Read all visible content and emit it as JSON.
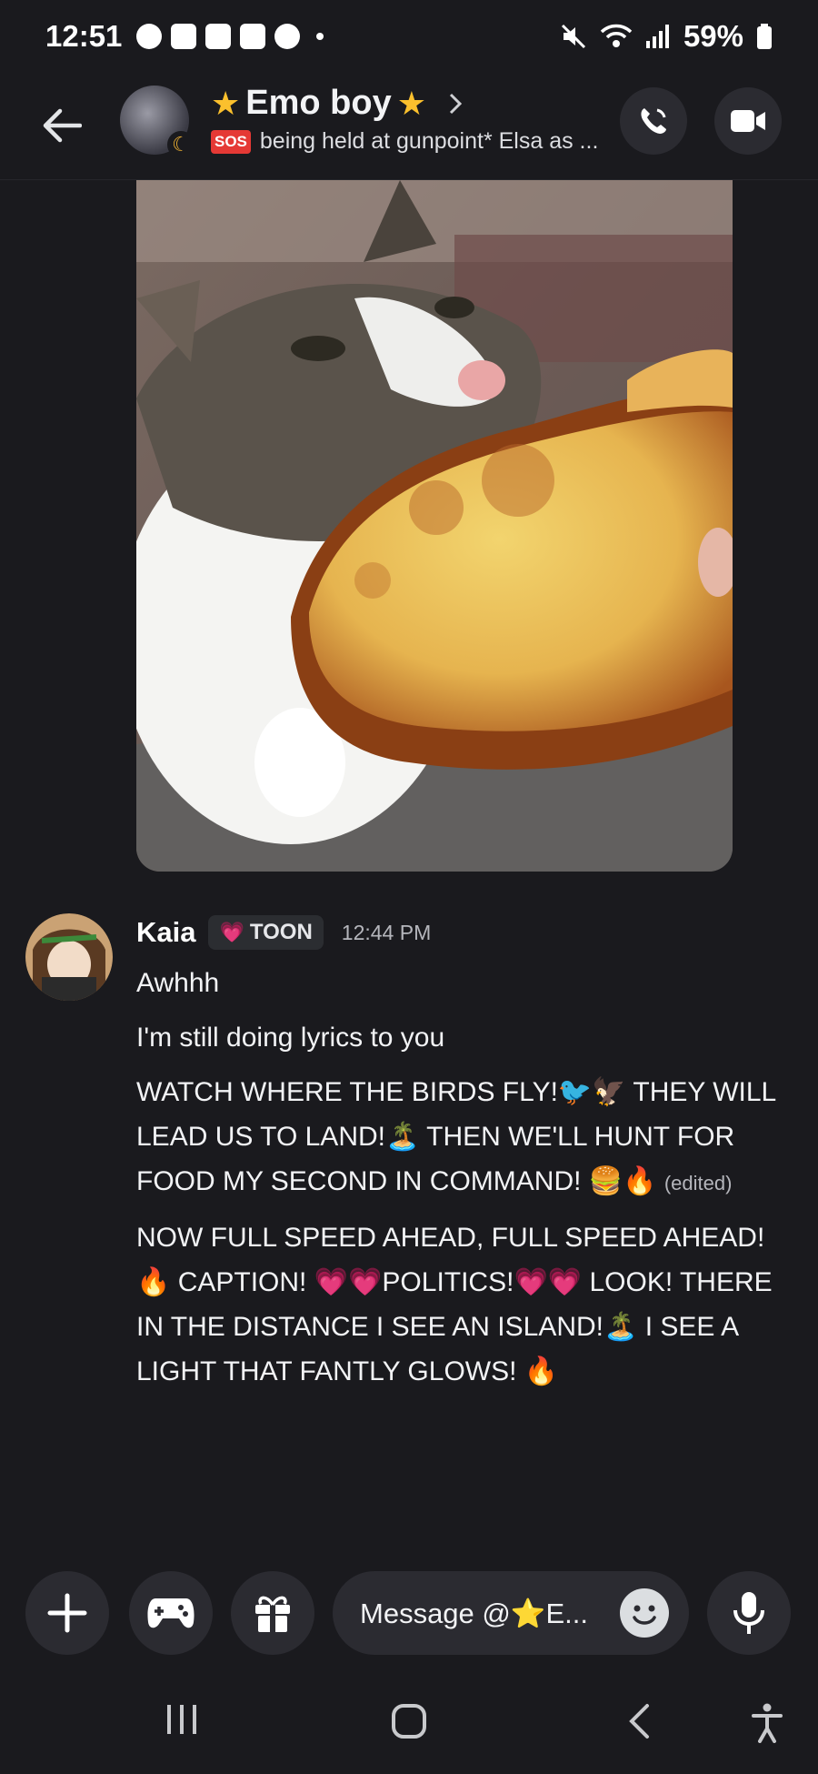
{
  "status_bar": {
    "time": "12:51",
    "battery": "59%"
  },
  "header": {
    "title_star_left": "★",
    "title": "Emo boy",
    "title_star_right": "★",
    "sos_badge": "SOS",
    "subtitle": "being held at gunpoint* Elsa as ..."
  },
  "message": {
    "username": "Kaia",
    "tag_label": "TOON",
    "timestamp": "12:44 PM",
    "lines": [
      "Awhhh",
      "I'm still doing lyrics to you"
    ],
    "verse1_a": "WATCH WHERE THE BIRDS FLY!🐦🦅 THEY WILL LEAD US TO LAND!🏝️ THEN WE'LL HUNT FOR FOOD MY SECOND IN COMMAND! 🍔🔥",
    "edited_label": "(edited)",
    "verse2": "NOW FULL SPEED AHEAD, FULL SPEED AHEAD!🔥 CAPTION! 💗💗POLITICS!💗💗 LOOK! THERE IN THE DISTANCE I SEE AN ISLAND!🏝️ I SEE A LIGHT THAT FANTLY GLOWS! 🔥"
  },
  "compose": {
    "placeholder": "Message @⭐E..."
  },
  "colors": {
    "background": "#1a1a1e",
    "button_bg": "#2b2b31",
    "star": "#fbc02d",
    "sos": "#e53935"
  }
}
